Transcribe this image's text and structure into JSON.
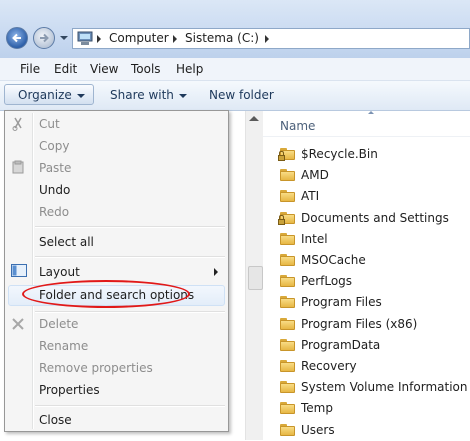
{
  "address": {
    "crumbs": [
      "Computer",
      "Sistema (C:)"
    ]
  },
  "menubar": {
    "items": [
      "File",
      "Edit",
      "View",
      "Tools",
      "Help"
    ]
  },
  "commandbar": {
    "organize": "Organize",
    "share_with": "Share with",
    "new_folder": "New folder"
  },
  "filelist": {
    "column_name": "Name",
    "items": [
      {
        "name": "$Recycle.Bin",
        "locked": true
      },
      {
        "name": "AMD",
        "locked": false
      },
      {
        "name": "ATI",
        "locked": false
      },
      {
        "name": "Documents and Settings",
        "locked": true
      },
      {
        "name": "Intel",
        "locked": false
      },
      {
        "name": "MSOCache",
        "locked": false
      },
      {
        "name": "PerfLogs",
        "locked": false
      },
      {
        "name": "Program Files",
        "locked": false
      },
      {
        "name": "Program Files (x86)",
        "locked": false
      },
      {
        "name": "ProgramData",
        "locked": false
      },
      {
        "name": "Recovery",
        "locked": false
      },
      {
        "name": "System Volume Information",
        "locked": false
      },
      {
        "name": "Temp",
        "locked": false
      },
      {
        "name": "Users",
        "locked": false
      }
    ]
  },
  "context_menu": {
    "cut": "Cut",
    "copy": "Copy",
    "paste": "Paste",
    "undo": "Undo",
    "redo": "Redo",
    "select_all": "Select all",
    "layout": "Layout",
    "folder_options": "Folder and search options",
    "delete": "Delete",
    "rename": "Rename",
    "remove_properties": "Remove properties",
    "properties": "Properties",
    "close": "Close"
  },
  "colors": {
    "annotation_circle": "#e11919",
    "folder_yellow": "#e7b744"
  }
}
